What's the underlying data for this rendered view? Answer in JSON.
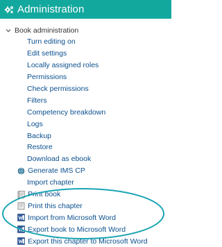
{
  "block": {
    "title": "Administration",
    "header_color": "#13a89e",
    "icon": "gears-icon"
  },
  "tree": {
    "root_label": "Book administration",
    "root_icon": "chevron-down-icon",
    "items": [
      {
        "label": "Turn editing on"
      },
      {
        "label": "Edit settings"
      },
      {
        "label": "Locally assigned roles"
      },
      {
        "label": "Permissions"
      },
      {
        "label": "Check permissions"
      },
      {
        "label": "Filters"
      },
      {
        "label": "Competency breakdown"
      },
      {
        "label": "Logs"
      },
      {
        "label": "Backup"
      },
      {
        "label": "Restore"
      },
      {
        "label": "Download as ebook"
      },
      {
        "label": "Generate IMS CP",
        "icon": "ims-cp-icon"
      },
      {
        "label": "Import chapter"
      },
      {
        "label": "Print book",
        "icon": "print-book-icon"
      },
      {
        "label": "Print this chapter",
        "icon": "print-chapter-icon"
      },
      {
        "label": "Import from Microsoft Word",
        "icon": "word-icon"
      },
      {
        "label": "Export book to Microsoft Word",
        "icon": "word-icon"
      },
      {
        "label": "Export this chapter to Microsoft Word",
        "icon": "word-icon"
      }
    ]
  },
  "highlight_color": "#1aa5b3",
  "link_color": "#0a4f8f"
}
